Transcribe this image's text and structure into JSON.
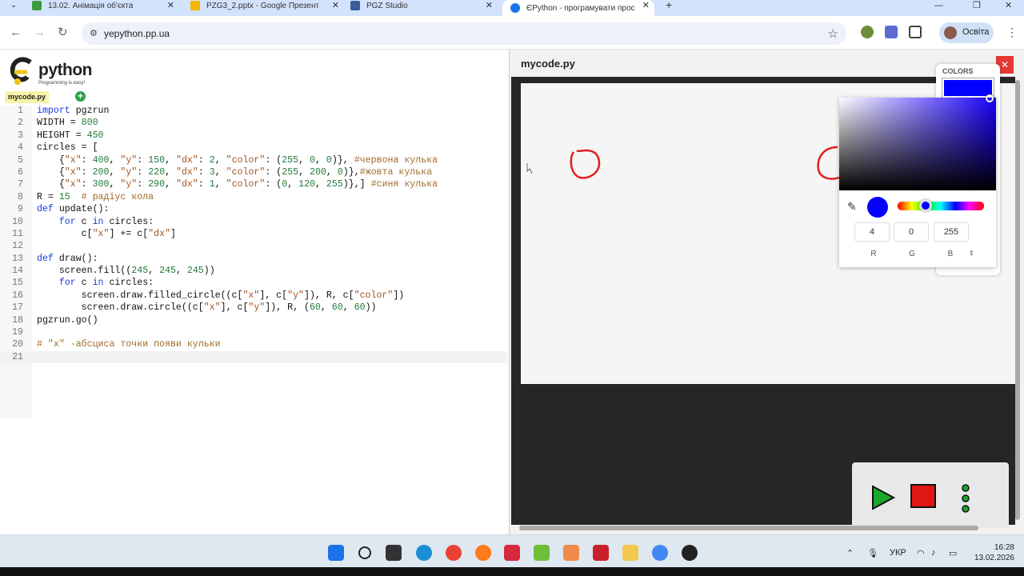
{
  "browser": {
    "tabs": [
      {
        "label": "13.02. Анімація об'єкта",
        "favicon_color": "#3b9b3f"
      },
      {
        "label": "PZG3_2.pptx - Google Презент",
        "favicon_color": "#f4b400"
      },
      {
        "label": "PGZ Studio",
        "favicon_color": "#3b5b9b"
      },
      {
        "label": "ЄPython - програмувати прос",
        "favicon_color": "#1a73e8"
      }
    ],
    "url": "yepython.pp.ua",
    "profile_label": "Освіта"
  },
  "editor": {
    "logo_text": "python",
    "logo_sub": "Programming is easy!",
    "file_tab": "mycode.py",
    "lines": [
      "import pgzrun",
      "WIDTH = 800",
      "HEIGHT = 450",
      "circles = [",
      "    {\"x\": 400, \"y\": 150, \"dx\": 2, \"color\": (255, 0, 0)}, #червона кулька",
      "    {\"x\": 200, \"y\": 220, \"dx\": 3, \"color\": (255, 200, 0)},#жовта кулька",
      "    {\"x\": 300, \"y\": 290, \"dx\": 1, \"color\": (0, 120, 255)},] #синя кулька",
      "R = 15  # радіус кола",
      "def update():",
      "    for c in circles:",
      "        c[\"x\"] += c[\"dx\"]",
      "",
      "def draw():",
      "    screen.fill((245, 245, 245))",
      "    for c in circles:",
      "        screen.draw.filled_circle((c[\"x\"], c[\"y\"]), R, c[\"color\"])",
      "        screen.draw.circle((c[\"x\"], c[\"y\"]), R, (60, 60, 60))",
      "pgzrun.go()",
      "",
      "# \"x\" -абсциса точки появи кульки",
      ""
    ]
  },
  "preview": {
    "title": "mycode.py",
    "canvas_bg": "#f5f5f5",
    "game_bg": "#262626"
  },
  "colors": {
    "title": "COLORS",
    "selected": "#0400ff",
    "r": "4",
    "g": "0",
    "b": "255",
    "r_label": "R",
    "g_label": "G",
    "b_label": "B",
    "toggle": "⇕"
  },
  "taskbar": {
    "lang": "УКР",
    "time": "16:28",
    "date": "13.02.2026"
  }
}
